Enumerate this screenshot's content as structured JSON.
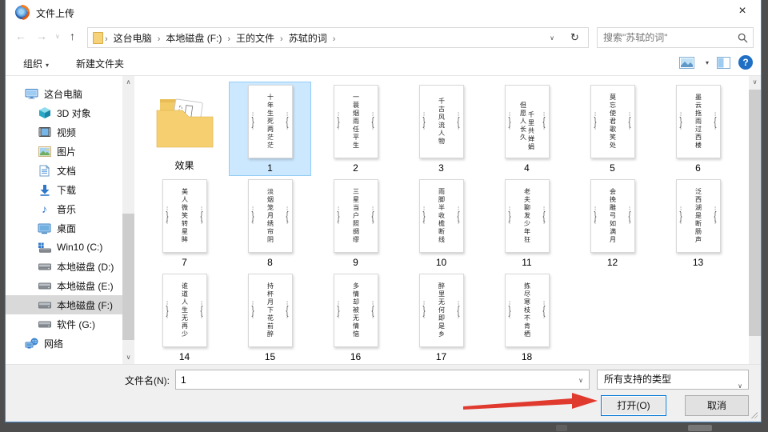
{
  "window": {
    "title": "文件上传",
    "close_glyph": "×"
  },
  "nav": {
    "back_glyph": "←",
    "forward_glyph": "→",
    "dropdown_glyph": "∨",
    "up_glyph": "↑",
    "refresh_glyph": "↻",
    "separator_glyph": "›",
    "breadcrumb": [
      "这台电脑",
      "本地磁盘 (F:)",
      "王的文件",
      "苏轼的词"
    ],
    "search_placeholder": "搜索\"苏轼的词\""
  },
  "toolbar": {
    "organize_label": "组织",
    "organize_caret": "▾",
    "new_folder_label": "新建文件夹",
    "help_glyph": "?"
  },
  "sidebar": {
    "items": [
      {
        "label": "这台电脑",
        "icon": "computer",
        "indent": 0
      },
      {
        "label": "3D 对象",
        "icon": "cube-3d",
        "indent": 1
      },
      {
        "label": "视频",
        "icon": "videos",
        "indent": 1
      },
      {
        "label": "图片",
        "icon": "pictures",
        "indent": 1
      },
      {
        "label": "文档",
        "icon": "documents",
        "indent": 1
      },
      {
        "label": "下载",
        "icon": "downloads",
        "indent": 1
      },
      {
        "label": "音乐",
        "icon": "music",
        "indent": 1
      },
      {
        "label": "桌面",
        "icon": "desktop",
        "indent": 1
      },
      {
        "label": "Win10 (C:)",
        "icon": "drive-win",
        "indent": 1
      },
      {
        "label": "本地磁盘 (D:)",
        "icon": "drive",
        "indent": 1
      },
      {
        "label": "本地磁盘 (E:)",
        "icon": "drive",
        "indent": 1
      },
      {
        "label": "本地磁盘 (F:)",
        "icon": "drive",
        "indent": 1,
        "selected": true
      },
      {
        "label": "软件 (G:)",
        "icon": "drive",
        "indent": 1
      },
      {
        "label": "网络",
        "icon": "network",
        "indent": 0
      }
    ],
    "scroll_up_glyph": "∧",
    "scroll_down_glyph": "∨"
  },
  "files": {
    "folder": {
      "name": "效果"
    },
    "ornament": {
      "dash": "¦",
      "left_brace": "}",
      "right_brace": "{"
    },
    "items": [
      {
        "name": "1",
        "text": "十年生死两茫茫",
        "selected": true
      },
      {
        "name": "2",
        "text": "一蓑烟雨任平生"
      },
      {
        "name": "3",
        "text": "千古风流人物"
      },
      {
        "name": "4",
        "text": "但愿人长久",
        "text2": "千里共婵娟"
      },
      {
        "name": "5",
        "text": "莫忘使君歌笑处"
      },
      {
        "name": "6",
        "text": "墨云拖雨过西楼"
      },
      {
        "name": "7",
        "text": "美人微笑转星眸"
      },
      {
        "name": "8",
        "text": "淡烟笼月绣帘阴"
      },
      {
        "name": "9",
        "text": "三星当户照绸缪"
      },
      {
        "name": "10",
        "text": "雨脚半收檐断线"
      },
      {
        "name": "11",
        "text": "老夫聊发少年狂"
      },
      {
        "name": "12",
        "text": "会挽雕弓如满月"
      },
      {
        "name": "13",
        "text": "泛西湖是断肠声"
      },
      {
        "name": "14",
        "text": "谁道人生无再少"
      },
      {
        "name": "15",
        "text": "持杯月下花前醉"
      },
      {
        "name": "16",
        "text": "多情却被无情恼"
      },
      {
        "name": "17",
        "text": "醉里无何即是乡"
      },
      {
        "name": "18",
        "text": "拣尽寒枝不肯栖"
      }
    ]
  },
  "footer": {
    "filename_label": "文件名(N):",
    "filename_value": "1",
    "filetype_value": "所有支持的类型",
    "open_label": "打开(O)",
    "cancel_label": "取消",
    "chevron_glyph": "∨"
  }
}
